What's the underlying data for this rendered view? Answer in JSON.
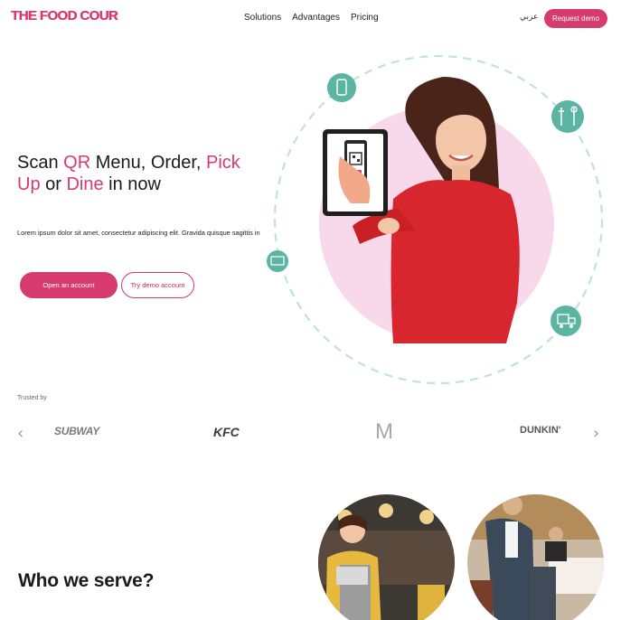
{
  "header": {
    "logo": "THE FOOD COUR",
    "nav": [
      "Solutions",
      "Advantages",
      "Pricing"
    ],
    "language": "عربي",
    "request_demo": "Request demo"
  },
  "hero": {
    "title_parts": [
      "Scan ",
      "QR",
      " Menu, Order, ",
      "Pick Up",
      " or ",
      "Dine",
      " in now"
    ],
    "description": "Lorem ipsum dolor sit amet, consectetur adipiscing elit. Gravida quisque sagittis in",
    "primary_button": "Open an account",
    "secondary_button": "Try demo account"
  },
  "trusted": {
    "label": "Trusted by",
    "brands": [
      "SUBWAY",
      "KFC",
      "M",
      "DUNKIN'"
    ],
    "prev_icon": "chevron-left-icon",
    "next_icon": "chevron-right-icon"
  },
  "serve": {
    "title": "Who we serve?"
  },
  "colors": {
    "accent": "#d63a6e",
    "teal": "#5bb5a2",
    "pink_bg": "#f8d9ec"
  }
}
